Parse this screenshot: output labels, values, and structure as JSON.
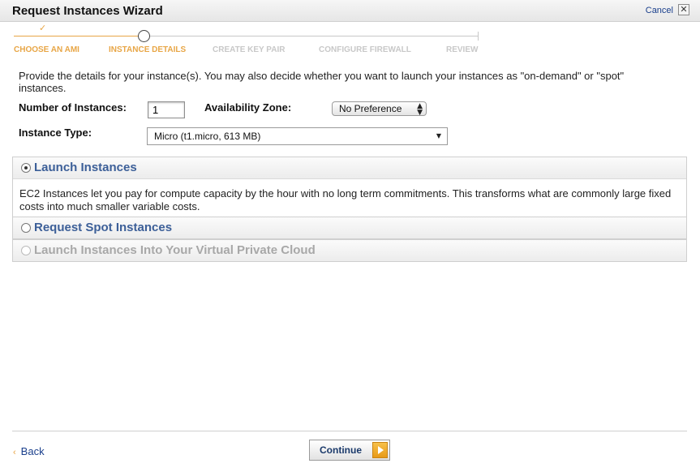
{
  "window": {
    "title": "Request Instances Wizard",
    "cancel_label": "Cancel",
    "close_glyph": "✕"
  },
  "steps": {
    "check_glyph": "✓",
    "items": [
      {
        "label": "CHOOSE AN AMI",
        "state": "done"
      },
      {
        "label": "INSTANCE DETAILS",
        "state": "current"
      },
      {
        "label": "CREATE KEY PAIR",
        "state": "todo"
      },
      {
        "label": "CONFIGURE FIREWALL",
        "state": "todo"
      },
      {
        "label": "REVIEW",
        "state": "todo"
      }
    ]
  },
  "intro": "Provide the details for your instance(s). You may also decide whether you want to launch your instances as \"on-demand\" or \"spot\" instances.",
  "form": {
    "num_instances_label": "Number of Instances:",
    "num_instances_value": "1",
    "az_label": "Availability Zone:",
    "az_value": "No Preference",
    "instance_type_label": "Instance Type:",
    "instance_type_value": "Micro (t1.micro, 613 MB)"
  },
  "options": [
    {
      "label": "Launch Instances",
      "selected": true,
      "enabled": true,
      "description": "EC2 Instances let you pay for compute capacity by the hour with no long term commitments. This transforms what are commonly large fixed costs into much smaller variable costs."
    },
    {
      "label": "Request Spot Instances",
      "selected": false,
      "enabled": true
    },
    {
      "label": "Launch Instances Into Your Virtual Private Cloud",
      "selected": false,
      "enabled": false
    }
  ],
  "footer": {
    "back_label": "Back",
    "back_glyph": "‹",
    "continue_label": "Continue"
  },
  "colors": {
    "accent_orange": "#e8a646",
    "link_blue": "#1a3f8c",
    "option_label_blue": "#3c5f98",
    "disabled_gray": "#a8a8a8"
  }
}
